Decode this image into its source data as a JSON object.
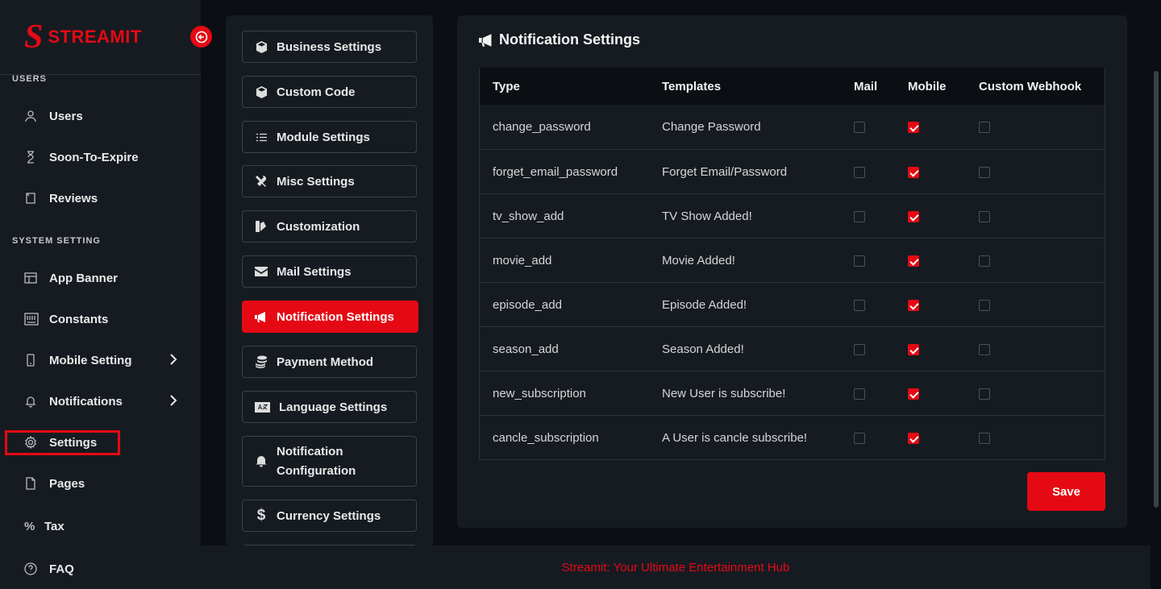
{
  "brand": {
    "logo_letter": "S",
    "name": "STREAMIT",
    "color": "#e50914"
  },
  "sidebar": {
    "sections": [
      {
        "title": "USERS"
      },
      {
        "title": "SYSTEM SETTING"
      }
    ],
    "items": [
      {
        "label": "Users",
        "icon": "user-icon"
      },
      {
        "label": "Soon-To-Expire",
        "icon": "hourglass-icon"
      },
      {
        "label": "Reviews",
        "icon": "review-icon"
      },
      {
        "label": "App Banner",
        "icon": "banner-icon"
      },
      {
        "label": "Constants",
        "icon": "keyboard-icon"
      },
      {
        "label": "Mobile Setting",
        "icon": "mobile-icon",
        "has_submenu": true
      },
      {
        "label": "Notifications",
        "icon": "bell-icon",
        "has_submenu": true
      },
      {
        "label": "Settings",
        "icon": "gear-icon",
        "highlighted": true
      },
      {
        "label": "Pages",
        "icon": "page-icon"
      },
      {
        "label": "Tax",
        "icon": "percent-icon"
      },
      {
        "label": "FAQ",
        "icon": "question-icon"
      }
    ]
  },
  "settings_nav": [
    {
      "label": "Business Settings",
      "icon": "cube-icon"
    },
    {
      "label": "Custom Code",
      "icon": "cube-icon"
    },
    {
      "label": "Module Settings",
      "icon": "list-icon"
    },
    {
      "label": "Misc Settings",
      "icon": "tools-icon"
    },
    {
      "label": "Customization",
      "icon": "swatch-icon"
    },
    {
      "label": "Mail Settings",
      "icon": "envelope-icon"
    },
    {
      "label": "Notification Settings",
      "icon": "megaphone-icon",
      "active": true
    },
    {
      "label": "Payment Method",
      "icon": "coins-icon"
    },
    {
      "label": "Language Settings",
      "icon": "language-icon"
    },
    {
      "label": "Notification Configuration",
      "line1": "Notification",
      "line2": "Configuration",
      "icon": "bell-icon"
    },
    {
      "label": "Currency Settings",
      "icon": "dollar-icon"
    }
  ],
  "notification_settings": {
    "title": "Notification Settings",
    "columns": [
      "Type",
      "Templates",
      "Mail",
      "Mobile",
      "Custom Webhook"
    ],
    "rows": [
      {
        "type": "change_password",
        "template": "Change Password",
        "mail": false,
        "mobile": true,
        "webhook": false
      },
      {
        "type": "forget_email_password",
        "template": "Forget Email/Password",
        "mail": false,
        "mobile": true,
        "webhook": false
      },
      {
        "type": "tv_show_add",
        "template": "TV Show Added!",
        "mail": false,
        "mobile": true,
        "webhook": false
      },
      {
        "type": "movie_add",
        "template": "Movie Added!",
        "mail": false,
        "mobile": true,
        "webhook": false
      },
      {
        "type": "episode_add",
        "template": "Episode Added!",
        "mail": false,
        "mobile": true,
        "webhook": false
      },
      {
        "type": "season_add",
        "template": "Season Added!",
        "mail": false,
        "mobile": true,
        "webhook": false
      },
      {
        "type": "new_subscription",
        "template": "New User is subscribe!",
        "mail": false,
        "mobile": true,
        "webhook": false
      },
      {
        "type": "cancle_subscription",
        "template": "A User is cancle subscribe!",
        "mail": false,
        "mobile": true,
        "webhook": false
      }
    ],
    "save_label": "Save"
  },
  "footer": {
    "text": "Streamit: Your Ultimate Entertainment Hub"
  }
}
